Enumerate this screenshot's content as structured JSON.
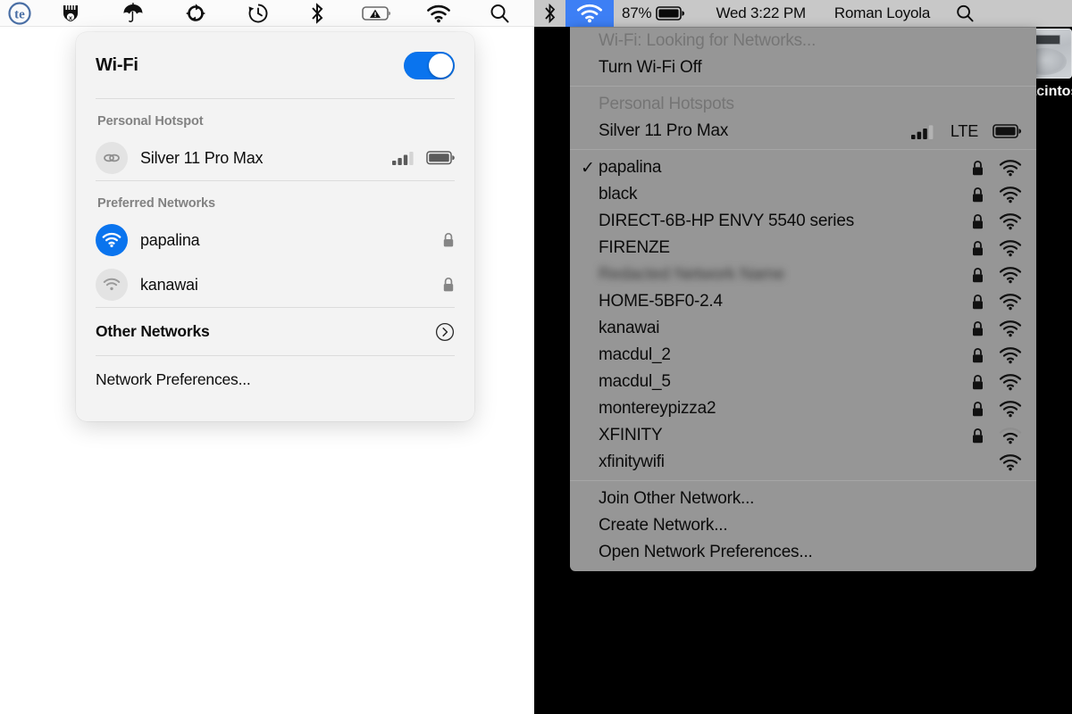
{
  "left": {
    "menubar": {
      "icons": [
        {
          "name": "texture-app-icon",
          "glyph": "te"
        },
        {
          "name": "istat-menus-icon",
          "glyph": "istat"
        },
        {
          "name": "umbrella-icon",
          "glyph": "umbrella"
        },
        {
          "name": "dropbox-sync-icon",
          "glyph": "sync"
        },
        {
          "name": "time-machine-icon",
          "glyph": "clock-back"
        },
        {
          "name": "bluetooth-icon",
          "glyph": "bluetooth"
        },
        {
          "name": "battery-warning-icon",
          "glyph": "battery-alert"
        },
        {
          "name": "wifi-icon",
          "glyph": "wifi"
        },
        {
          "name": "spotlight-search-icon",
          "glyph": "magnifier"
        }
      ]
    },
    "popover": {
      "title": "Wi-Fi",
      "toggle_state": "on",
      "accent_color": "#0a74ee",
      "sections": [
        {
          "label": "Personal Hotspot",
          "items": [
            {
              "name": "Silver 11 Pro Max",
              "icon": "link-chain-icon",
              "signal_bars": 3,
              "battery": "full",
              "selected": false
            }
          ]
        },
        {
          "label": "Preferred Networks",
          "items": [
            {
              "name": "papalina",
              "icon": "wifi-icon",
              "selected": true,
              "locked": true
            },
            {
              "name": "kanawai",
              "icon": "wifi-icon",
              "selected": false,
              "locked": true
            }
          ]
        }
      ],
      "other_networks_label": "Other Networks",
      "other_networks_chevron": "chevron-right-circle-icon",
      "network_preferences_label": "Network Preferences..."
    }
  },
  "right": {
    "menubar": {
      "bluetooth_icon": "bluetooth-icon",
      "wifi_icon": "wifi-icon",
      "wifi_selected": true,
      "highlight_color": "#3d7ff5",
      "battery_percent": "87%",
      "battery_icon": "battery-full-icon",
      "clock": "Wed 3:22 PM",
      "user": "Roman Loyola",
      "search_icon": "spotlight-search-icon"
    },
    "desktop": {
      "icon_name": "macintosh-hd-icon",
      "icon_label": "Macintosh HD"
    },
    "menu": {
      "status_line": "Wi-Fi: Looking for Networks...",
      "toggle_item": "Turn Wi-Fi Off",
      "hotspots_header": "Personal Hotspots",
      "hotspot": {
        "name": "Silver 11 Pro Max",
        "signal_bars": 3,
        "carrier": "LTE",
        "battery": "full"
      },
      "networks": [
        {
          "name": "papalina",
          "checked": true,
          "locked": true,
          "signal": "strong",
          "blurred": false
        },
        {
          "name": "black",
          "checked": false,
          "locked": true,
          "signal": "strong",
          "blurred": false
        },
        {
          "name": "DIRECT-6B-HP ENVY 5540 series",
          "checked": false,
          "locked": true,
          "signal": "strong",
          "blurred": false
        },
        {
          "name": "FIRENZE",
          "checked": false,
          "locked": true,
          "signal": "strong",
          "blurred": false
        },
        {
          "name": "Redacted Network Name",
          "checked": false,
          "locked": true,
          "signal": "strong",
          "blurred": true
        },
        {
          "name": "HOME-5BF0-2.4",
          "checked": false,
          "locked": true,
          "signal": "strong",
          "blurred": false
        },
        {
          "name": "kanawai",
          "checked": false,
          "locked": true,
          "signal": "strong",
          "blurred": false
        },
        {
          "name": "macdul_2",
          "checked": false,
          "locked": true,
          "signal": "strong",
          "blurred": false
        },
        {
          "name": "macdul_5",
          "checked": false,
          "locked": true,
          "signal": "strong",
          "blurred": false
        },
        {
          "name": "montereypizza2",
          "checked": false,
          "locked": true,
          "signal": "strong",
          "blurred": false
        },
        {
          "name": "XFINITY",
          "checked": false,
          "locked": true,
          "signal": "weak",
          "blurred": false
        },
        {
          "name": "xfinitywifi",
          "checked": false,
          "locked": false,
          "signal": "strong",
          "blurred": false
        }
      ],
      "actions": [
        "Join Other Network...",
        "Create Network...",
        "Open Network Preferences..."
      ]
    }
  }
}
